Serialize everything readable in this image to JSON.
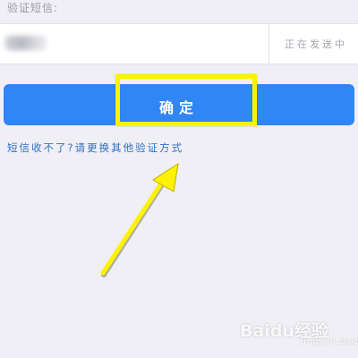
{
  "verification": {
    "section_label": "验证短信:",
    "status_text": "正在发送中"
  },
  "confirm": {
    "label": "确定"
  },
  "help": {
    "link_text": "短信收不了?请更换其他验证方式"
  },
  "annotation": {
    "highlight_color": "#fff200",
    "arrow_color": "#fff200"
  },
  "watermark": {
    "brand": "Baidu经验",
    "sub": "jingyan.baidu.com"
  },
  "colors": {
    "background": "#f0eff5",
    "accent": "#2f86f4",
    "link": "#2f6fc5"
  }
}
